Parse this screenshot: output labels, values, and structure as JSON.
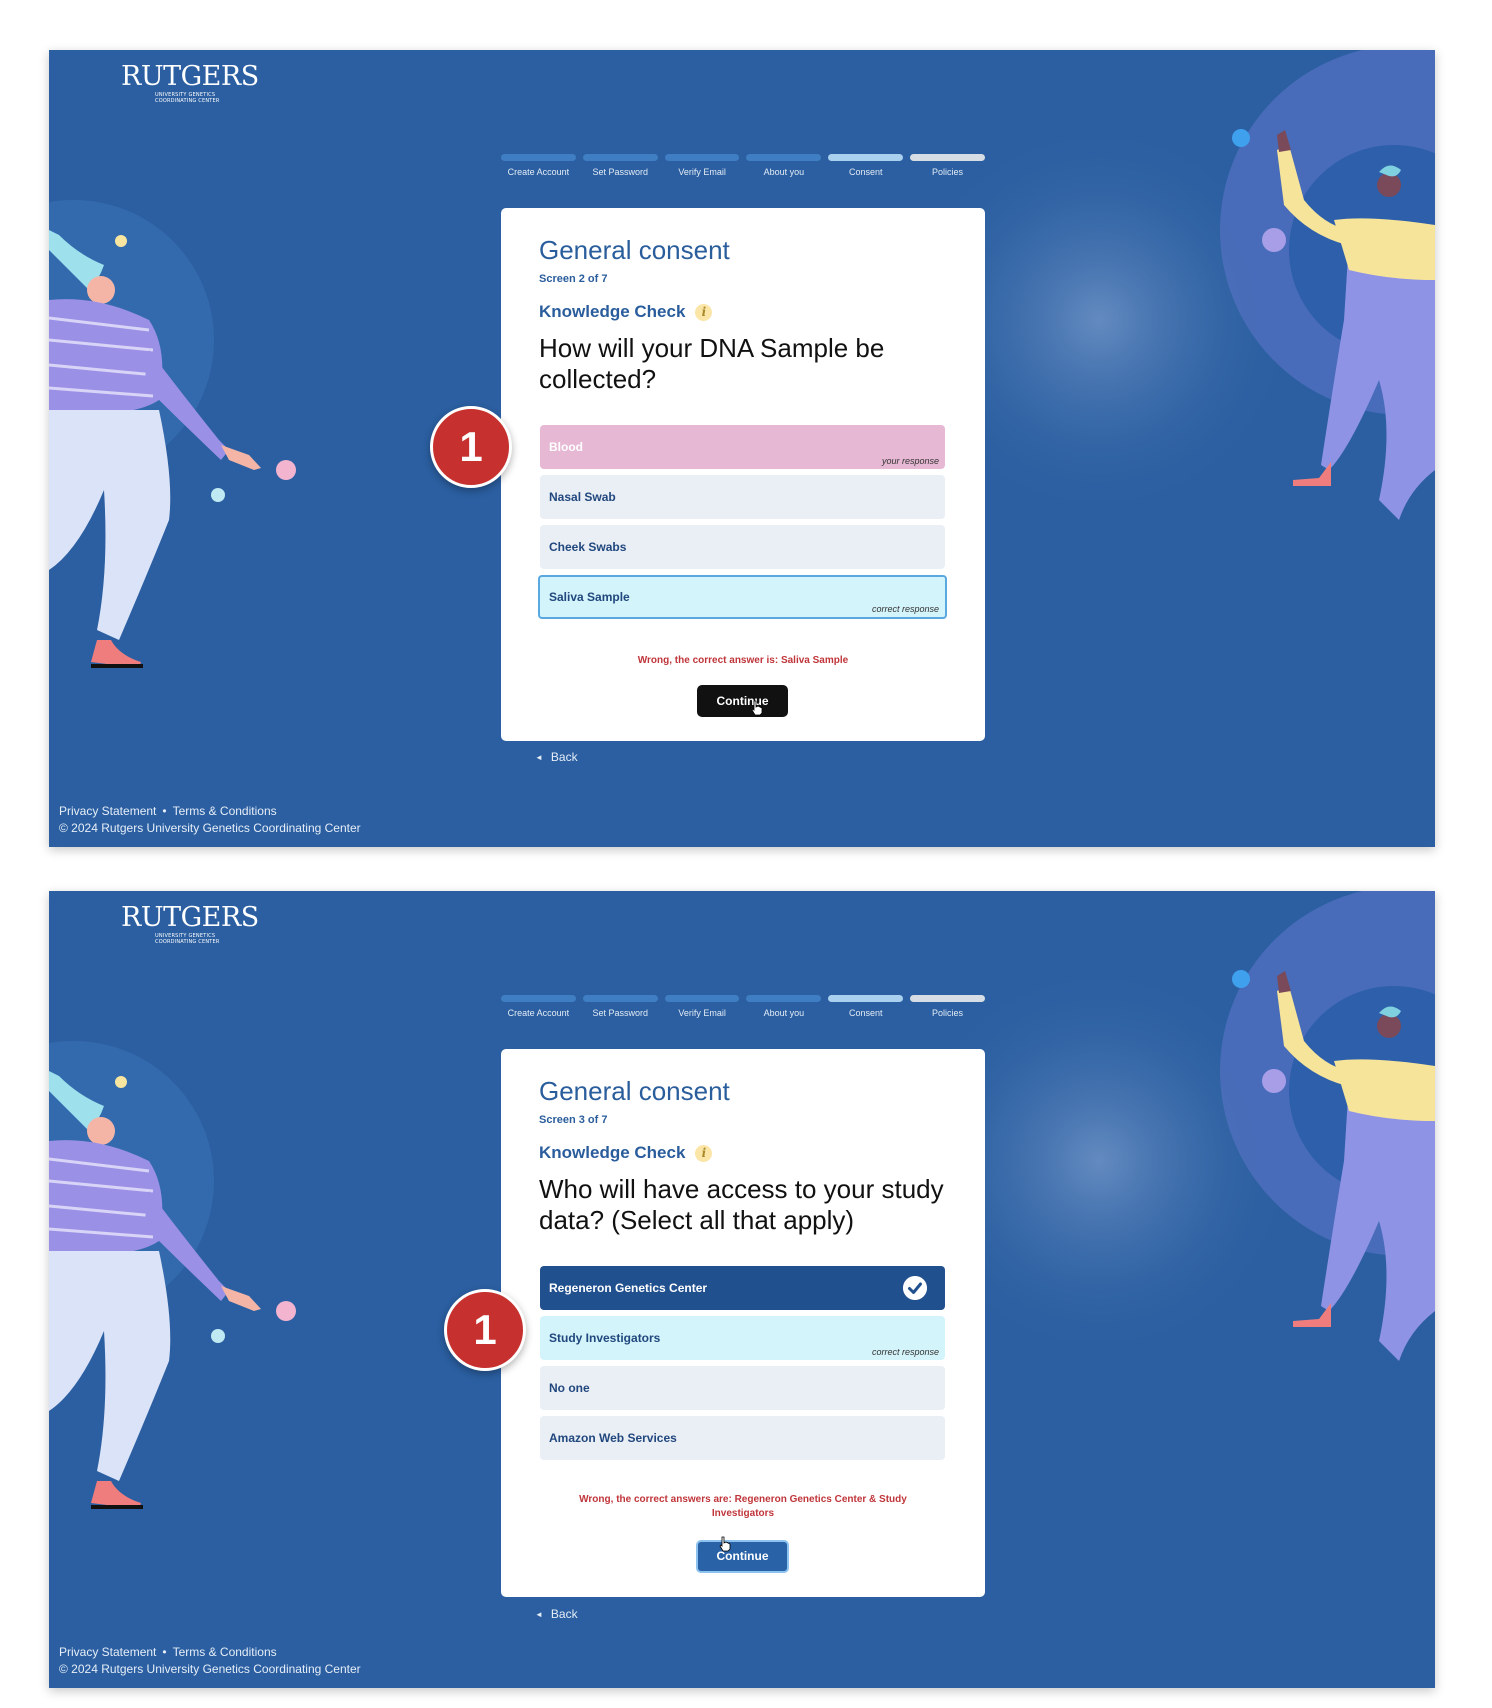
{
  "logo": {
    "wordmark": "RUTGERS",
    "subtitle_line1": "UNIVERSITY GENETICS",
    "subtitle_line2": "COORDINATING CENTER"
  },
  "progress_steps": [
    "Create Account",
    "Set Password",
    "Verify Email",
    "About you",
    "Consent",
    "Policies"
  ],
  "current_step": "Consent",
  "colors": {
    "background": "#2b5fa1",
    "card": "#ffffff",
    "title": "#2a5d9c",
    "wrong_option": "#e6b8d4",
    "correct_option": "#d3f4fa",
    "selected_option": "#21508f",
    "error_text": "#c0353a",
    "step_badge": "#c6312f"
  },
  "screens": [
    {
      "title": "General consent",
      "screen_number": "Screen 2 of 7",
      "section": "Knowledge Check",
      "info_icon": "info-icon",
      "question": "How will your DNA Sample be collected?",
      "options": [
        {
          "label": "Blood",
          "note": "your response",
          "state": "wrong"
        },
        {
          "label": "Nasal Swab",
          "note": "",
          "state": "default"
        },
        {
          "label": "Cheek Swabs",
          "note": "",
          "state": "default"
        },
        {
          "label": "Saliva Sample",
          "note": "correct response",
          "state": "correct"
        }
      ],
      "feedback": "Wrong, the correct answer is: Saliva Sample",
      "continue_label": "Continue",
      "back_label": "Back",
      "step_badge": "1"
    },
    {
      "title": "General consent",
      "screen_number": "Screen 3 of 7",
      "section": "Knowledge Check",
      "info_icon": "info-icon",
      "question": "Who will have access to your study data? (Select all that apply)",
      "options": [
        {
          "label": "Regeneron Genetics Center",
          "note": "",
          "state": "selected"
        },
        {
          "label": "Study Investigators",
          "note": "correct response",
          "state": "correct"
        },
        {
          "label": "No one",
          "note": "",
          "state": "default"
        },
        {
          "label": "Amazon Web Services",
          "note": "",
          "state": "default"
        }
      ],
      "feedback": "Wrong, the correct answers are: Regeneron Genetics Center & Study Investigators",
      "continue_label": "Continue",
      "back_label": "Back",
      "step_badge": "1"
    }
  ],
  "footer": {
    "privacy": "Privacy Statement",
    "terms": "Terms & Conditions",
    "copyright": "© 2024 Rutgers University Genetics Coordinating Center"
  }
}
